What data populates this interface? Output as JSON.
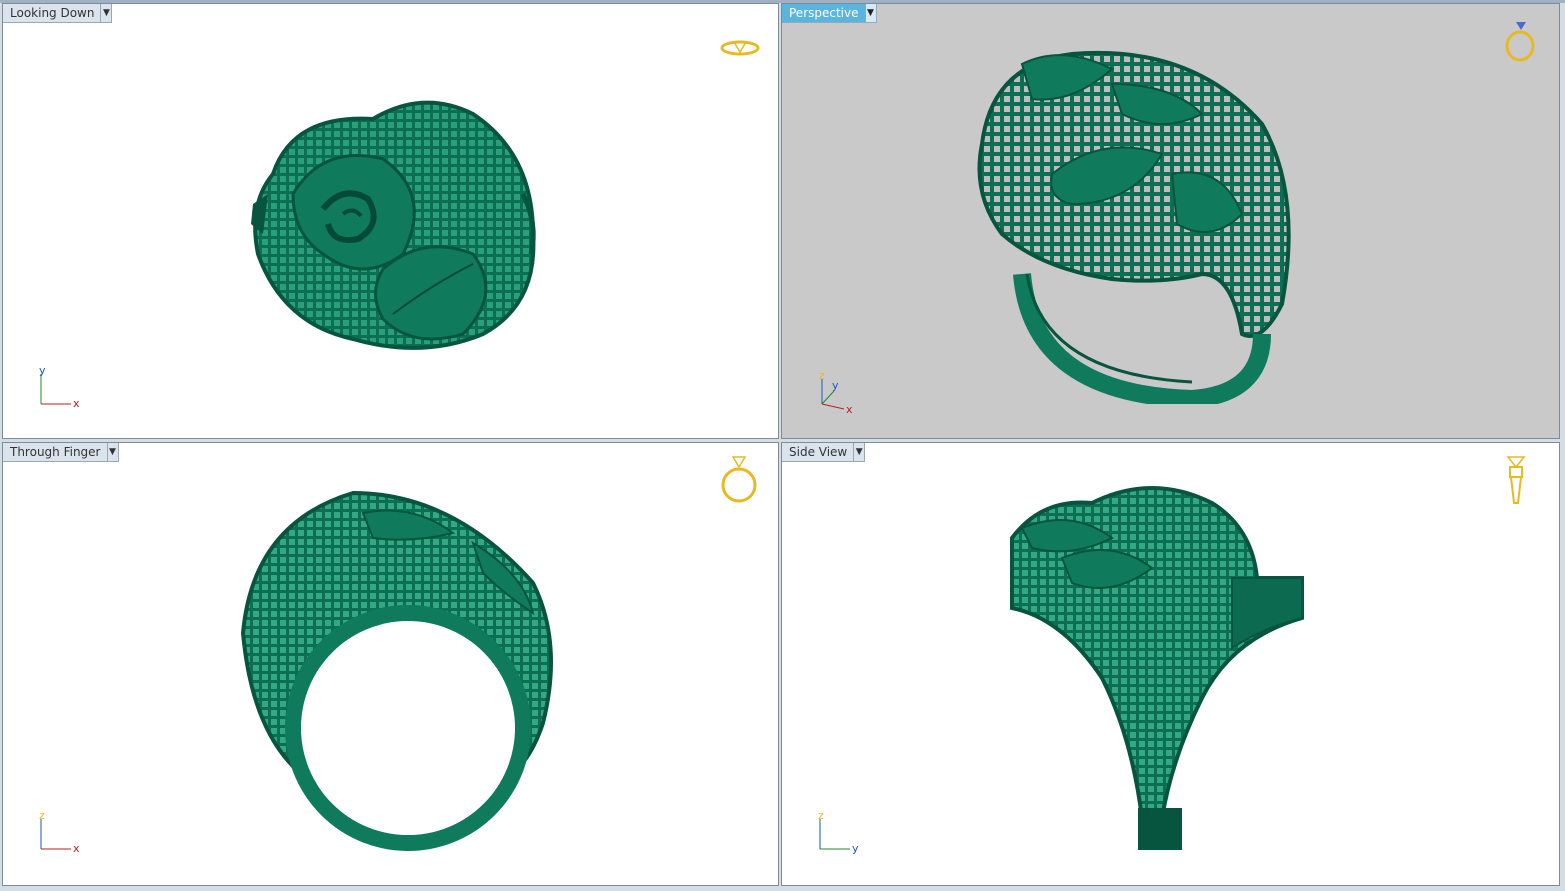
{
  "viewports": [
    {
      "name": "Looking Down",
      "axis1": "y",
      "axis2": "x",
      "active": false
    },
    {
      "name": "Perspective",
      "axis1": "z",
      "axis2": "y",
      "axis3": "x",
      "active": true
    },
    {
      "name": "Through Finger",
      "axis1": "z",
      "axis2": "x",
      "active": false
    },
    {
      "name": "Side View",
      "axis1": "z",
      "axis2": "y",
      "active": false
    }
  ],
  "colors": {
    "model_green": "#0f7a5c",
    "model_dark": "#07553f",
    "active_tab": "#5ab4e0",
    "gizmo_gold": "#e8b923",
    "axis_red": "#b8201e",
    "axis_green": "#1e8a2e",
    "axis_blue": "#1a57c9"
  },
  "icons": {
    "dropdown": "chevron-down-icon",
    "gizmo": "ring-view-icon"
  }
}
